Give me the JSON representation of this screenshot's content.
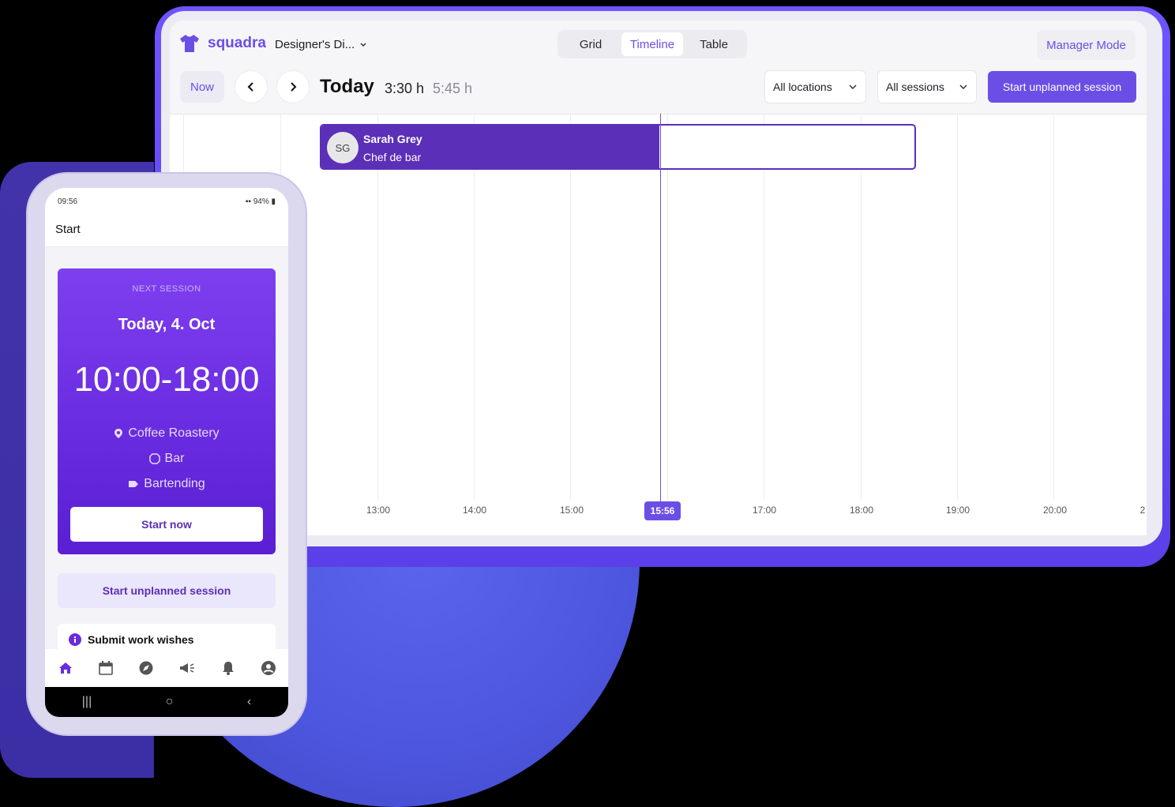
{
  "brand": {
    "name": "squadra",
    "accent": "#6b4ee6",
    "shift_color": "#5b2fb8"
  },
  "header": {
    "workspace": "Designer's Di...",
    "view_tabs": [
      {
        "label": "Grid",
        "active": false
      },
      {
        "label": "Timeline",
        "active": true
      },
      {
        "label": "Table",
        "active": false
      }
    ],
    "manager_mode": "Manager Mode"
  },
  "toolbar": {
    "now_label": "Now",
    "date_label": "Today",
    "duration_worked": "3:30 h",
    "duration_planned": "5:45 h",
    "locations_select": "All locations",
    "sessions_select": "All sessions",
    "start_unplanned": "Start unplanned session"
  },
  "timeline": {
    "ticks": [
      "13:00",
      "14:00",
      "15:00",
      "17:00",
      "18:00",
      "19:00",
      "20:00",
      "2"
    ],
    "now_label": "15:56",
    "shift": {
      "initials": "SG",
      "name": "Sarah Grey",
      "role": "Chef de bar",
      "elapsed_fraction": 0.57
    }
  },
  "phone": {
    "status_time": "09:56",
    "status_right": "94%",
    "screen_title": "Start",
    "next_session": {
      "label": "NEXT SESSION",
      "date": "Today, 4. Oct",
      "time": "10:00-18:00",
      "location": "Coffee Roastery",
      "area": "Bar",
      "task": "Bartending",
      "start_button": "Start now"
    },
    "start_unplanned": "Start unplanned session",
    "submit_wishes": "Submit work wishes",
    "tabs": [
      "home-icon",
      "calendar-icon",
      "compass-icon",
      "megaphone-icon",
      "bell-icon",
      "profile-icon"
    ]
  }
}
